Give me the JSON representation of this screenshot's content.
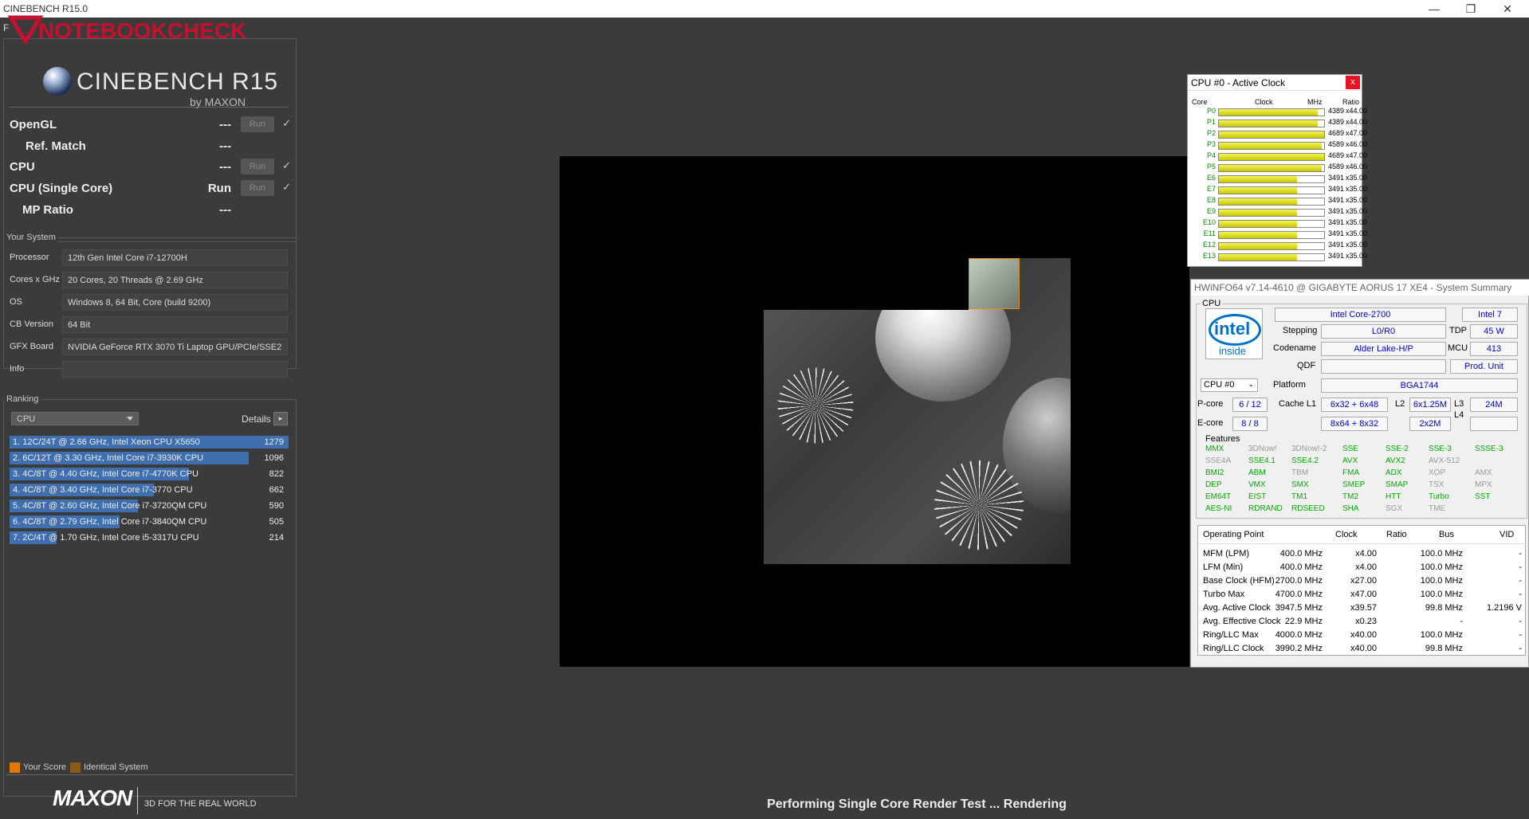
{
  "window": {
    "title": "CINEBENCH R15.0",
    "min": "—",
    "max": "❐",
    "close": "✕"
  },
  "watermark": "NOTEBOOKCHECK",
  "cinebench": {
    "logo_name": "CINEBENCH R15",
    "logo_by": "by MAXON",
    "menu_f": "F"
  },
  "tests": [
    {
      "label": "OpenGL",
      "value": "---",
      "run": "Run",
      "check": "✓"
    },
    {
      "label": "Ref. Match",
      "value": "---"
    },
    {
      "label": "CPU",
      "value": "---",
      "run": "Run",
      "check": "✓"
    },
    {
      "label": "CPU (Single Core)",
      "value": "Run",
      "run": "Run",
      "check": "✓"
    },
    {
      "label": "MP Ratio",
      "value": "---"
    }
  ],
  "your_system": {
    "title": "Your System",
    "rows": [
      {
        "label": "Processor",
        "value": "12th Gen Intel Core i7-12700H"
      },
      {
        "label": "Cores x GHz",
        "value": "20 Cores, 20 Threads @ 2.69 GHz"
      },
      {
        "label": "OS",
        "value": "Windows 8, 64 Bit, Core (build 9200)"
      },
      {
        "label": "CB Version",
        "value": "64 Bit"
      },
      {
        "label": "GFX Board",
        "value": "NVIDIA GeForce RTX 3070 Ti Laptop GPU/PCIe/SSE2"
      },
      {
        "label": "Info",
        "value": ""
      }
    ]
  },
  "ranking": {
    "title": "Ranking",
    "select_value": "CPU",
    "details_label": "Details",
    "details_btn": "▸",
    "max_score": 1279,
    "rows": [
      {
        "label": "1. 12C/24T @ 2.66 GHz, Intel Xeon CPU X5650",
        "score": "1279",
        "value": 1279
      },
      {
        "label": "2. 6C/12T @ 3.30 GHz,  Intel Core i7-3930K CPU",
        "score": "1096",
        "value": 1096
      },
      {
        "label": "3. 4C/8T @ 4.40 GHz, Intel Core i7-4770K CPU",
        "score": "822",
        "value": 822
      },
      {
        "label": "4. 4C/8T @ 3.40 GHz,  Intel Core i7-3770 CPU",
        "score": "662",
        "value": 662
      },
      {
        "label": "5. 4C/8T @ 2.60 GHz, Intel Core i7-3720QM CPU",
        "score": "590",
        "value": 590
      },
      {
        "label": "6. 4C/8T @ 2.79 GHz,  Intel Core i7-3840QM CPU",
        "score": "505",
        "value": 505
      },
      {
        "label": "7. 2C/4T @ 1.70 GHz,  Intel Core i5-3317U CPU",
        "score": "214",
        "value": 214
      }
    ],
    "legend_your_score": "Your Score",
    "legend_identical": "Identical System",
    "color_your_score": "#e07b00",
    "color_identical": "#8a5a1a",
    "bar_color": "#3f6fae"
  },
  "footer": {
    "brand": "MAXON",
    "slogan": "3D FOR THE REAL WORLD",
    "status": "Performing Single Core Render Test ... Rendering"
  },
  "clock_window": {
    "title": "CPU #0 - Active Clock",
    "close": "x",
    "col_core": "Core",
    "col_clock": "Clock",
    "col_mhz": "MHz",
    "col_ratio": "Ratio",
    "max_mhz": 4689,
    "rows": [
      {
        "core": "P0",
        "mhz": "4389",
        "ratio": "x44.00",
        "value": 4389
      },
      {
        "core": "P1",
        "mhz": "4389",
        "ratio": "x44.00",
        "value": 4389
      },
      {
        "core": "P2",
        "mhz": "4689",
        "ratio": "x47.00",
        "value": 4689
      },
      {
        "core": "P3",
        "mhz": "4589",
        "ratio": "x46.00",
        "value": 4589
      },
      {
        "core": "P4",
        "mhz": "4689",
        "ratio": "x47.00",
        "value": 4689
      },
      {
        "core": "P5",
        "mhz": "4589",
        "ratio": "x46.00",
        "value": 4589
      },
      {
        "core": "E6",
        "mhz": "3491",
        "ratio": "x35.00",
        "value": 3491
      },
      {
        "core": "E7",
        "mhz": "3491",
        "ratio": "x35.00",
        "value": 3491
      },
      {
        "core": "E8",
        "mhz": "3491",
        "ratio": "x35.00",
        "value": 3491
      },
      {
        "core": "E9",
        "mhz": "3491",
        "ratio": "x35.00",
        "value": 3491
      },
      {
        "core": "E10",
        "mhz": "3491",
        "ratio": "x35.00",
        "value": 3491
      },
      {
        "core": "E11",
        "mhz": "3491",
        "ratio": "x35.00",
        "value": 3491
      },
      {
        "core": "E12",
        "mhz": "3491",
        "ratio": "x35.00",
        "value": 3491
      },
      {
        "core": "E13",
        "mhz": "3491",
        "ratio": "x35.00",
        "value": 3491
      }
    ]
  },
  "hwinfo": {
    "title": "HWiNFO64 v7.14-4610 @ GIGABYTE AORUS 17 XE4 - System Summary",
    "cpu_group": "CPU",
    "intel_word": "intel",
    "intel_inside": "inside",
    "cpu_name": "Intel Core-2700",
    "cpu_brand": "Intel 7",
    "stepping_label": "Stepping",
    "stepping": "L0/R0",
    "tdp_label": "TDP",
    "tdp": "45 W",
    "codename_label": "Codename",
    "codename": "Alder Lake-H/P",
    "mcu_label": "MCU",
    "mcu": "413",
    "qdf_label": "QDF",
    "qdf": "",
    "prod_unit": "Prod. Unit",
    "cpu_select": "CPU #0",
    "platform_label": "Platform",
    "platform": "BGA1744",
    "pcore_label": "P-core",
    "pcore": "6 / 12",
    "cachel1_label": "Cache L1",
    "pcore_l1": "6x32 + 6x48",
    "l2_label": "L2",
    "pcore_l2": "6x1.25M",
    "l3_label": "L3",
    "l3": "24M",
    "l4_label": "L4",
    "ecore_label": "E-core",
    "ecore": "8 / 8",
    "ecore_l1": "8x64 + 8x32",
    "ecore_l2": "2x2M",
    "features_label": "Features",
    "features": [
      [
        {
          "t": "MMX",
          "on": true
        },
        {
          "t": "3DNow!",
          "on": false
        },
        {
          "t": "3DNow!-2",
          "on": false
        },
        {
          "t": "SSE",
          "on": true
        },
        {
          "t": "SSE-2",
          "on": true
        },
        {
          "t": "SSE-3",
          "on": true
        },
        {
          "t": "SSSE-3",
          "on": true
        }
      ],
      [
        {
          "t": "SSE4A",
          "on": false
        },
        {
          "t": "SSE4.1",
          "on": true
        },
        {
          "t": "SSE4.2",
          "on": true
        },
        {
          "t": "AVX",
          "on": true
        },
        {
          "t": "AVX2",
          "on": true
        },
        {
          "t": "AVX-512",
          "on": false
        }
      ],
      [
        {
          "t": "BMI2",
          "on": true
        },
        {
          "t": "ABM",
          "on": true
        },
        {
          "t": "TBM",
          "on": false
        },
        {
          "t": "FMA",
          "on": true
        },
        {
          "t": "ADX",
          "on": true
        },
        {
          "t": "XOP",
          "on": false
        },
        {
          "t": "AMX",
          "on": false
        }
      ],
      [
        {
          "t": "DEP",
          "on": true
        },
        {
          "t": "VMX",
          "on": true
        },
        {
          "t": "SMX",
          "on": true
        },
        {
          "t": "SMEP",
          "on": true
        },
        {
          "t": "SMAP",
          "on": true
        },
        {
          "t": "TSX",
          "on": false
        },
        {
          "t": "MPX",
          "on": false
        }
      ],
      [
        {
          "t": "EM64T",
          "on": true
        },
        {
          "t": "EIST",
          "on": true
        },
        {
          "t": "TM1",
          "on": true
        },
        {
          "t": "TM2",
          "on": true
        },
        {
          "t": "HTT",
          "on": true
        },
        {
          "t": "Turbo",
          "on": true
        },
        {
          "t": "SST",
          "on": true
        }
      ],
      [
        {
          "t": "AES-NI",
          "on": true
        },
        {
          "t": "RDRAND",
          "on": true
        },
        {
          "t": "RDSEED",
          "on": true
        },
        {
          "t": "SHA",
          "on": true
        },
        {
          "t": "SGX",
          "on": false
        },
        {
          "t": "TME",
          "on": false
        }
      ]
    ],
    "op_headers": {
      "point": "Operating Point",
      "clock": "Clock",
      "ratio": "Ratio",
      "bus": "Bus",
      "vid": "VID"
    },
    "op_rows": [
      {
        "point": "MFM (LPM)",
        "clock": "400.0 MHz",
        "ratio": "x4.00",
        "bus": "100.0 MHz",
        "vid": "-"
      },
      {
        "point": "LFM (Min)",
        "clock": "400.0 MHz",
        "ratio": "x4.00",
        "bus": "100.0 MHz",
        "vid": "-"
      },
      {
        "point": "Base Clock (HFM)",
        "clock": "2700.0 MHz",
        "ratio": "x27.00",
        "bus": "100.0 MHz",
        "vid": "-"
      },
      {
        "point": "Turbo Max",
        "clock": "4700.0 MHz",
        "ratio": "x47.00",
        "bus": "100.0 MHz",
        "vid": "-"
      },
      {
        "point": "Avg. Active Clock",
        "clock": "3947.5 MHz",
        "ratio": "x39.57",
        "bus": "99.8 MHz",
        "vid": "1.2196 V"
      },
      {
        "point": "Avg. Effective Clock",
        "clock": "22.9 MHz",
        "ratio": "x0.23",
        "bus": "-",
        "vid": "-"
      },
      {
        "point": "Ring/LLC Max",
        "clock": "4000.0 MHz",
        "ratio": "x40.00",
        "bus": "100.0 MHz",
        "vid": "-"
      },
      {
        "point": "Ring/LLC Clock",
        "clock": "3990.2 MHz",
        "ratio": "x40.00",
        "bus": "99.8 MHz",
        "vid": "-"
      }
    ]
  }
}
